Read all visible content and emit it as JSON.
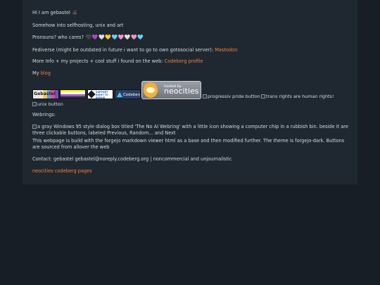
{
  "greeting": "Hi I am gebastel",
  "greeting_emoji": "👋🏿",
  "intro": "Somehow into selfhosting, unix and art",
  "pronouns_label": "Pronouns? who cares?",
  "hearts": [
    "🖤",
    "💜",
    "🤍",
    "💛",
    "🩵",
    "🩷",
    "🤍",
    "🩷",
    "🩵"
  ],
  "fediverse_text": "Fediverse (might be outdated in future i want to go to own gotosocial server): ",
  "fediverse_link": "Mastodon",
  "more_info_text": "More Info + my projects + cool stuff i found on the web: ",
  "more_info_link": "Codeberg profile",
  "blog_prefix": "My ",
  "blog_link": "blog",
  "buttons": {
    "gebastel": "Gebastel",
    "right_to_repair": "SUPPORT RIGHT TO REPAIR",
    "codeberg": "Codeberg",
    "neocities_small": "hosted by",
    "neocities_big": "neocities",
    "pride_alt": "progressiv pride button",
    "trans_alt": "trans rights are human rights!",
    "unix_alt": "unix button"
  },
  "webrings_label": "Webrings:",
  "webring_alt": "a gray Windows 95 style dialog box titled 'The No AI Webring' with a little icon showing a computer chip in a rubbish bin. beside it are three clickable buttons, labeled Previous, Random... and Next",
  "build_note": "This webpage is build with the forgejo markdown viewer html as a base and then modified further. The theme is forgejo-dark. Buttons are sourced from allover the web",
  "contact": "Contact: gebastel gebastel@noreply.codeberg.org | noncommercial and unjournalistic",
  "footer_link": "neocities codeberg pages",
  "colors": {
    "page_bg": "#171e26",
    "card_bg": "#1f2830",
    "link": "#f1823a",
    "text": "#d4dae2"
  }
}
